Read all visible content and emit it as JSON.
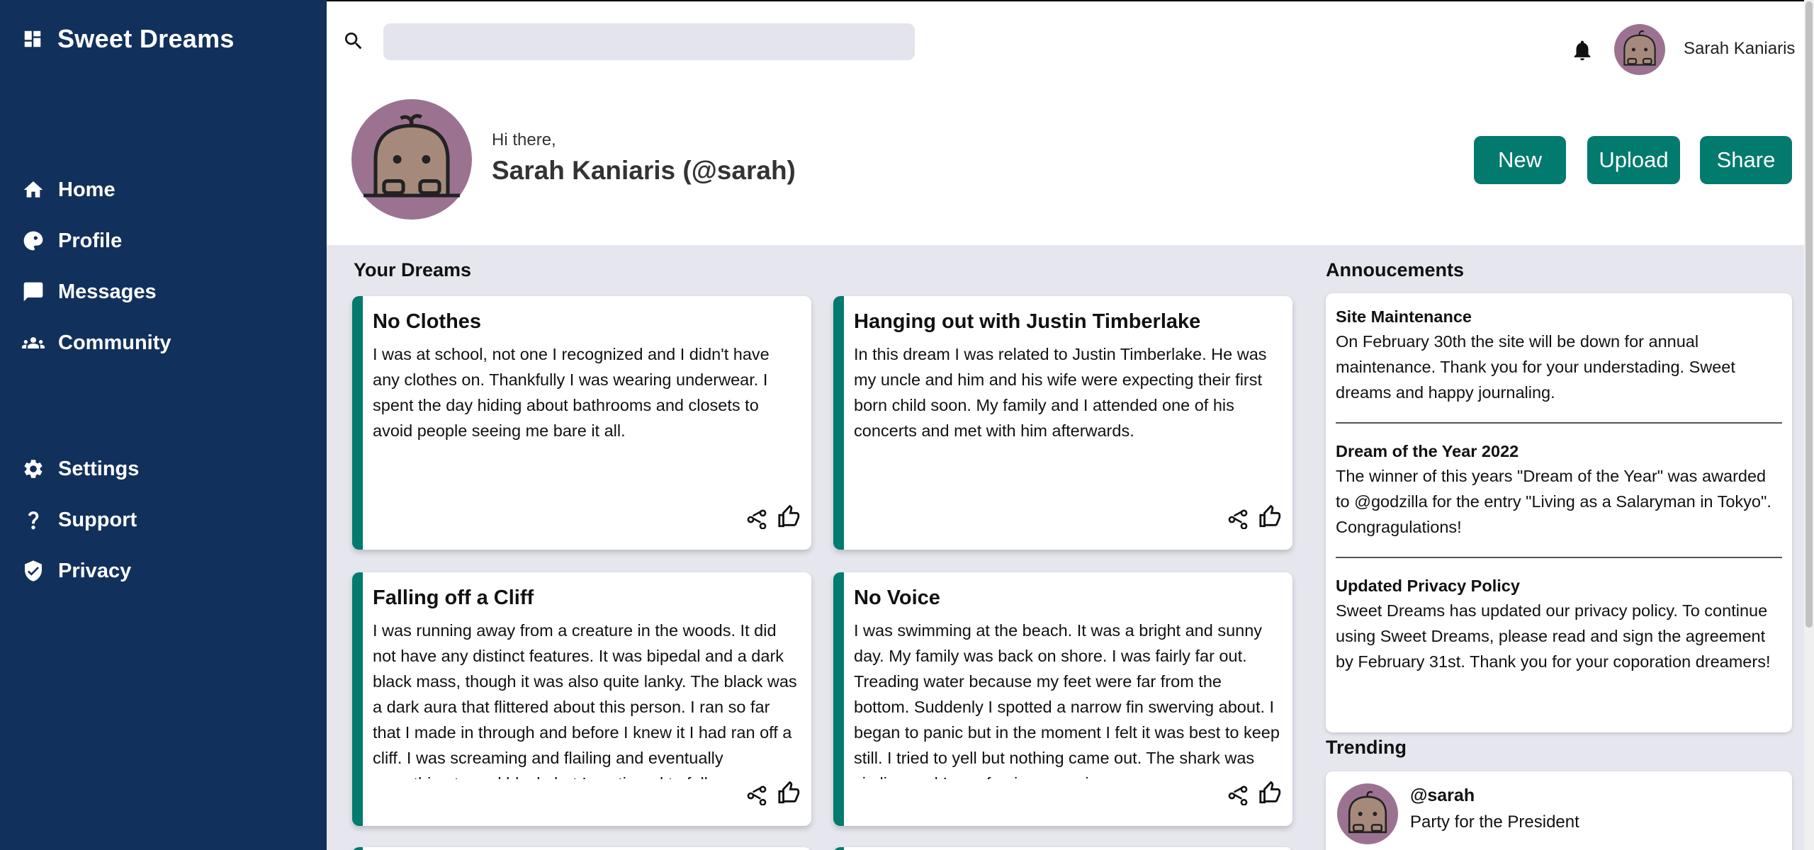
{
  "app": {
    "title": "Sweet Dreams"
  },
  "sidebar": {
    "main_items": [
      {
        "label": "Home",
        "icon": "home-icon"
      },
      {
        "label": "Profile",
        "icon": "profile-icon"
      },
      {
        "label": "Messages",
        "icon": "messages-icon"
      },
      {
        "label": "Community",
        "icon": "community-icon"
      }
    ],
    "secondary_items": [
      {
        "label": "Settings",
        "icon": "gear-icon"
      },
      {
        "label": "Support",
        "icon": "question-icon"
      },
      {
        "label": "Privacy",
        "icon": "shield-icon"
      }
    ]
  },
  "topbar": {
    "search_placeholder": "",
    "username": "Sarah Kaniaris"
  },
  "header": {
    "greeting": "Hi there,",
    "name": "Sarah Kaniaris (@sarah)",
    "buttons": {
      "new": "New",
      "upload": "Upload",
      "share": "Share"
    }
  },
  "dreams": {
    "title": "Your Dreams",
    "cards": [
      {
        "title": "No Clothes",
        "body": "I was at school, not one I recognized and I didn't have any clothes on. Thankfully I was wearing underwear. I spent the day hiding about bathrooms and closets to avoid people seeing me bare it all."
      },
      {
        "title": "Hanging out with Justin Timberlake",
        "body": "In this dream I was related to Justin Timberlake. He was my uncle and him and his wife were expecting their first born child soon. My family and I attended one of his concerts and met with him afterwards."
      },
      {
        "title": "Falling off a Cliff",
        "body": "I was running away from a creature in the woods. It did not have any distinct features. It was bipedal and a dark black mass, though it was also quite lanky. The black was a dark aura that flittered about this person. I ran so far that I made in through and before I knew it I had ran off a cliff. I was screaming and flailing and eventually everything turned black, but I continued to fall."
      },
      {
        "title": "No Voice",
        "body": "I was swimming at the beach. It was a bright and sunny day. My family was back on shore. I was fairly far out. Treading water because my feet were far from the bottom. Suddenly I spotted a narrow fin swerving about. I began to panic but in the moment I felt it was best to keep still. I tried to yell but nothing came out. The shark was circling and I was forcing my voice so"
      }
    ]
  },
  "announcements": {
    "title": "Annoucements",
    "items": [
      {
        "title": "Site Maintenance",
        "body": "On February 30th the site will be down for annual maintenance. Thank you for your understading. Sweet dreams and happy journaling."
      },
      {
        "title": "Dream of the Year 2022",
        "body": "The winner of this years \"Dream of the Year\" was awarded to @godzilla for the entry \"Living as a Salaryman in Tokyo\". Congragulations!"
      },
      {
        "title": "Updated Privacy Policy",
        "body": "Sweet Dreams has updated our privacy policy. To continue using Sweet Dreams, please read and sign the agreement by February 31st. Thank you for your coporation dreamers!"
      }
    ]
  },
  "trending": {
    "title": "Trending",
    "items": [
      {
        "user": "@sarah",
        "text": "Party for the President"
      }
    ]
  },
  "colors": {
    "sidebar": "#12305c",
    "accent": "#037a6e",
    "avatar_bg": "#9b7391",
    "background": "#e6e7ee"
  }
}
